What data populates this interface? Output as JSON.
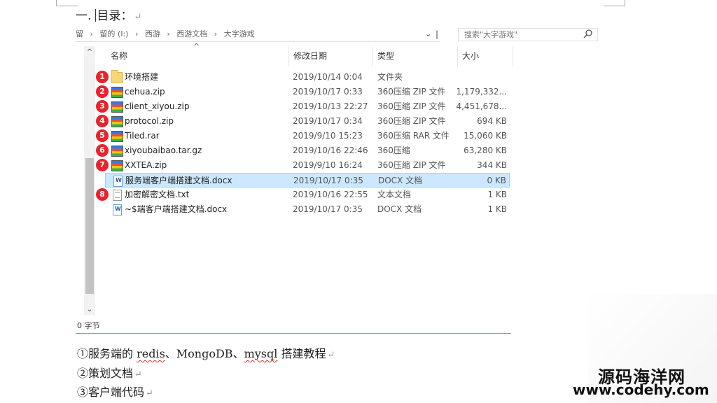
{
  "doc": {
    "heading_prefix": "一.",
    "heading_text": "目录：",
    "para_mark": "↵",
    "lines": [
      {
        "parts": [
          "①服务端的 ",
          "redis",
          "、MongoDB、",
          "mysql",
          " 搭建教程"
        ]
      },
      {
        "text": "②策划文档"
      },
      {
        "text": "③客户端代码"
      }
    ]
  },
  "explorer": {
    "breadcrumb": [
      "留",
      "›",
      "留的 (I:)",
      "›",
      "西游",
      "›",
      "西游文档",
      "›",
      "大字游戏"
    ],
    "search_placeholder": "搜索\"大字游戏\"",
    "columns": {
      "name": "名称",
      "date": "修改日期",
      "type": "类型",
      "size": "大小"
    },
    "files": [
      {
        "badge": "1",
        "icon": "folder-icon",
        "name": "环境搭建",
        "date": "2019/10/14 0:04",
        "type": "文件夹",
        "size": ""
      },
      {
        "badge": "2",
        "icon": "zip-archive-icon",
        "name": "cehua.zip",
        "date": "2019/10/17 0:33",
        "type": "360压缩 ZIP 文件",
        "size": "1,179,332..."
      },
      {
        "badge": "3",
        "icon": "zip-archive-icon",
        "name": "client_xiyou.zip",
        "date": "2019/10/13 22:27",
        "type": "360压缩 ZIP 文件",
        "size": "4,451,678..."
      },
      {
        "badge": "4",
        "icon": "zip-archive-icon",
        "name": "protocol.zip",
        "date": "2019/10/17 0:34",
        "type": "360压缩 ZIP 文件",
        "size": "694 KB"
      },
      {
        "badge": "5",
        "icon": "rar-archive-icon",
        "name": "Tiled.rar",
        "date": "2019/9/10 15:23",
        "type": "360压缩 RAR 文件",
        "size": "15,060 KB"
      },
      {
        "badge": "6",
        "icon": "gz-archive-icon",
        "name": "xiyoubaibao.tar.gz",
        "date": "2019/10/16 22:46",
        "type": "360压缩",
        "size": "63,280 KB"
      },
      {
        "badge": "7",
        "icon": "zip-archive-icon",
        "name": "XXTEA.zip",
        "date": "2019/9/10 16:24",
        "type": "360压缩 ZIP 文件",
        "size": "344 KB"
      },
      {
        "badge": "",
        "icon": "docx-file-icon",
        "name": "服务端客户端搭建文档.docx",
        "date": "2019/10/17 0:35",
        "type": "DOCX 文档",
        "size": "0 KB",
        "selected": true
      },
      {
        "badge": "8",
        "icon": "txt-file-icon",
        "name": "加密解密文档.txt",
        "date": "2019/10/16 22:55",
        "type": "文本文档",
        "size": "1 KB"
      },
      {
        "badge": "",
        "icon": "docx-file-icon",
        "name": "~$端客户端搭建文档.docx",
        "date": "2019/10/17 0:35",
        "type": "DOCX 文档",
        "size": "1 KB"
      }
    ],
    "status": "0 字节"
  },
  "watermark": {
    "cn": "源码海洋网",
    "url": "www.codehy.com"
  },
  "colors": {
    "badge": "#e8232b",
    "selection": "#cce8ff",
    "status_line": "#6fa0d6"
  }
}
